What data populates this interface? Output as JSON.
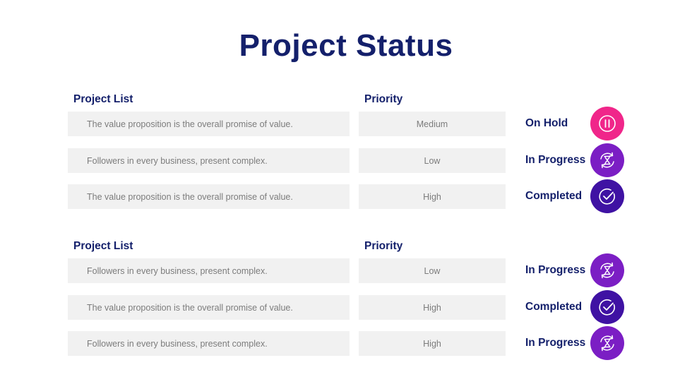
{
  "title": "Project Status",
  "colors": {
    "heading": "#14206b",
    "cell_bg": "#f1f1f1",
    "cell_text": "#7c7c7c",
    "on_hold": "#f0268a",
    "in_progress": "#7b1ec4",
    "completed": "#3f12a3"
  },
  "sections": [
    {
      "project_header": "Project List",
      "priority_header": "Priority",
      "rows": [
        {
          "project": "The value proposition is the overall promise of value.",
          "priority": "Medium",
          "status": "On Hold",
          "icon": "pause-icon"
        },
        {
          "project": "Followers in every business, present complex.",
          "priority": "Low",
          "status": "In Progress",
          "icon": "hourglass-refresh-icon"
        },
        {
          "project": "The value proposition is the overall promise of value.",
          "priority": "High",
          "status": "Completed",
          "icon": "check-circle-icon"
        }
      ]
    },
    {
      "project_header": "Project List",
      "priority_header": "Priority",
      "rows": [
        {
          "project": "Followers in every business, present complex.",
          "priority": "Low",
          "status": "In Progress",
          "icon": "hourglass-refresh-icon"
        },
        {
          "project": "The value proposition is the overall promise of value.",
          "priority": "High",
          "status": "Completed",
          "icon": "check-circle-icon"
        },
        {
          "project": "Followers in every business, present complex.",
          "priority": "High",
          "status": "In Progress",
          "icon": "hourglass-refresh-icon"
        }
      ]
    }
  ]
}
